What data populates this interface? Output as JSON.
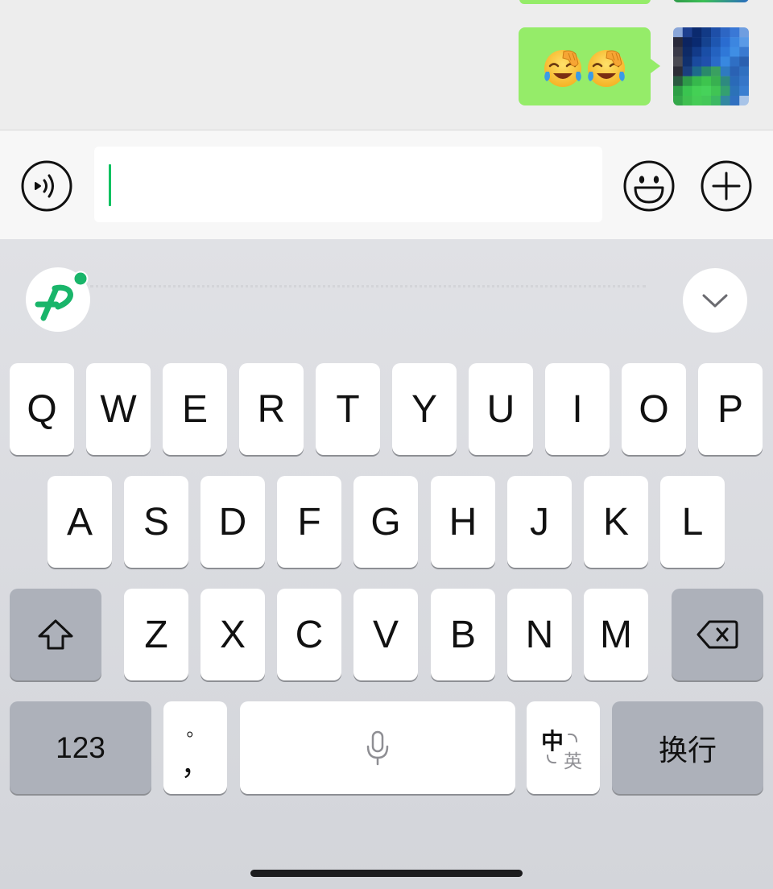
{
  "chat": {
    "message": {
      "side": "right",
      "emojis": [
        "facepalm-emoji",
        "facepalm-emoji"
      ],
      "avatar": "pixelated-avatar-image"
    }
  },
  "input_bar": {
    "voice_icon": "voice-input-icon",
    "value": "",
    "emoji_icon": "smiley-emoji-icon",
    "more_icon": "plus-circle-icon"
  },
  "keyboard": {
    "toolbar": {
      "logo_icon": "pinyin-ime-logo-icon",
      "collapse_icon": "chevron-down-icon"
    },
    "rows": [
      [
        "Q",
        "W",
        "E",
        "R",
        "T",
        "Y",
        "U",
        "I",
        "O",
        "P"
      ],
      [
        "A",
        "S",
        "D",
        "F",
        "G",
        "H",
        "J",
        "K",
        "L"
      ],
      [
        "Z",
        "X",
        "C",
        "V",
        "B",
        "N",
        "M"
      ]
    ],
    "shift_icon": "shift-icon",
    "delete_icon": "delete-backspace-icon",
    "numbers_label": "123",
    "punctuation_top": "。",
    "punctuation_main": "，",
    "space_icon": "microphone-icon",
    "language_primary": "中",
    "language_secondary": "英",
    "return_label": "换行"
  },
  "colors": {
    "accent": "#07c160",
    "bubble": "#95ec69",
    "chat_background": "#ededed",
    "key": "#ffffff",
    "function_key": "#adb1ba"
  }
}
